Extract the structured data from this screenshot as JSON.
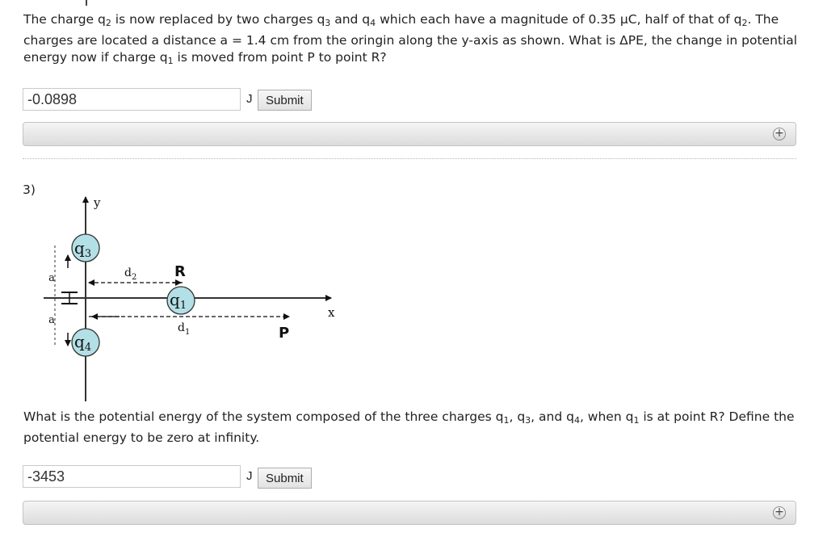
{
  "part2": {
    "question_line1": "The charge q",
    "q2_sub": "2",
    "question_line1b": " is now replaced by two charges q",
    "q3_sub": "3",
    "and_q": " and q",
    "q4_sub": "4",
    "question_line1c": " which each have a magnitude of 0.35 μC, half of that of q",
    "q2_sub_b": "2",
    "question_line1d": ". The charges are located a distance a = 1.4 cm from the oringin along the y-axis as shown. What is ΔPE, the change in potential energy now if charge q",
    "q1_sub": "1",
    "question_line1e": " is moved from point P to point R?",
    "answer_value": "-0.0898",
    "unit": "J",
    "submit_label": "Submit",
    "expand_icon": "+"
  },
  "part3": {
    "number": "3)",
    "question_a": "What is the potential energy of the system composed of the three charges q",
    "q1_sub": "1",
    "comma1": ", q",
    "q3_sub": "3",
    "comma2": ", and q",
    "q4_sub": "4",
    "question_b": ", when q",
    "q1_sub_b": "1",
    "question_c": " is at point R? Define the potential energy to be zero at infinity.",
    "answer_value": "-3453",
    "unit": "J",
    "submit_label": "Submit",
    "expand_icon": "+"
  },
  "figure": {
    "y_label": "y",
    "x_label": "x",
    "a_top": "a",
    "a_bottom": "a",
    "q3_label": "q",
    "q3_sub": "3",
    "q4_label": "q",
    "q4_sub": "4",
    "q1_label": "q",
    "q1_sub": "1",
    "d2_label": "d",
    "d2_sub": "2",
    "d1_label": "d",
    "d1_sub": "1",
    "r_label": "R",
    "p_label": "P",
    "circle_color": "#b3dfe6"
  }
}
